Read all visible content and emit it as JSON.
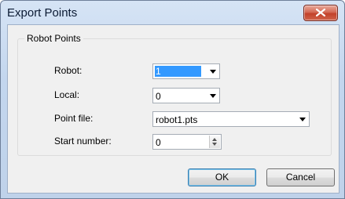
{
  "window": {
    "title": "Export Points"
  },
  "group": {
    "legend": "Robot Points"
  },
  "fields": {
    "robot": {
      "label": "Robot:",
      "value": "1"
    },
    "local": {
      "label": "Local:",
      "value": "0"
    },
    "point_file": {
      "label": "Point file:",
      "value": "robot1.pts"
    },
    "start_number": {
      "label": "Start number:",
      "value": "0"
    }
  },
  "buttons": {
    "ok": "OK",
    "cancel": "Cancel"
  },
  "colors": {
    "selection": "#3399ff",
    "close_button": "#c2412a"
  }
}
